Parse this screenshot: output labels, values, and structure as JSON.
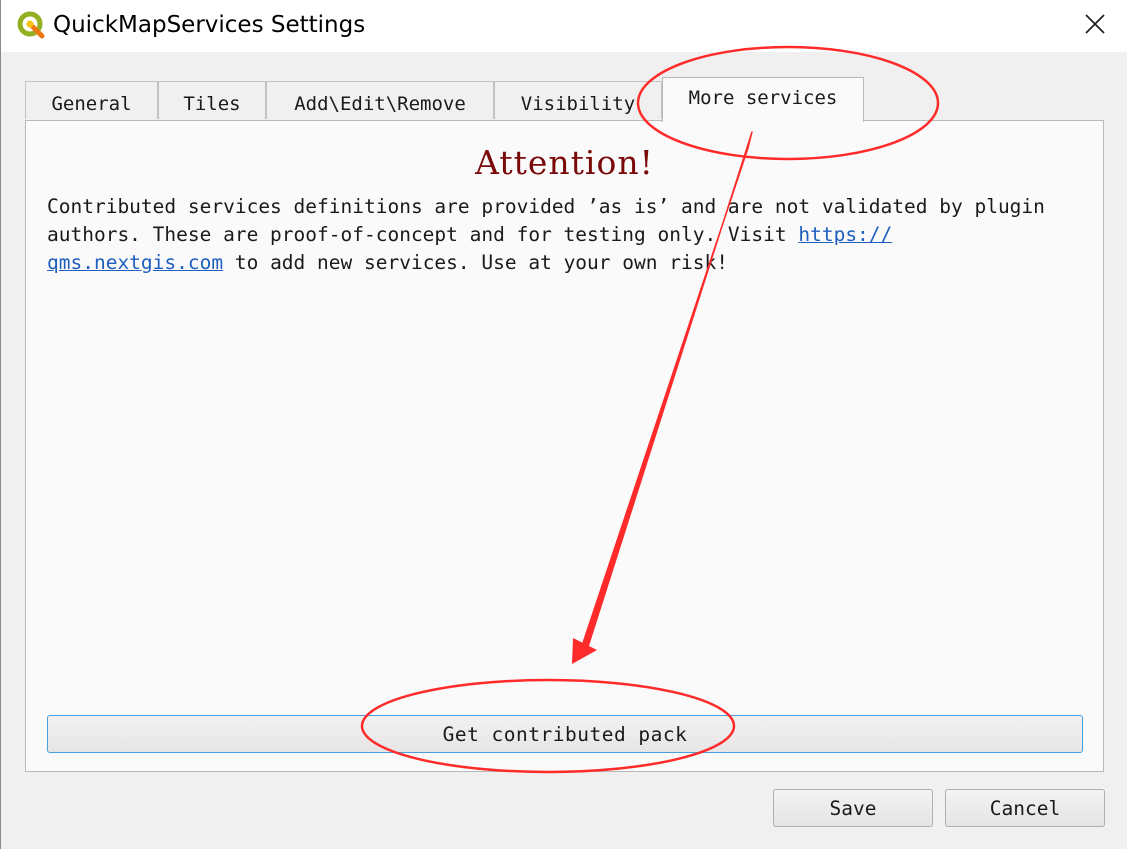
{
  "window": {
    "title": "QuickMapServices Settings",
    "app_icon": "qgis-logo-icon",
    "close_icon": "close-icon"
  },
  "tabs": [
    {
      "label": "General",
      "active": false
    },
    {
      "label": "Tiles",
      "active": false
    },
    {
      "label": "Add\\Edit\\Remove",
      "active": false
    },
    {
      "label": "Visibility",
      "active": false
    },
    {
      "label": "More services",
      "active": true
    }
  ],
  "more_services": {
    "heading": "Attention!",
    "text_before_link": "Contributed services definitions are provided ’as is’ and are not validated by plugin authors. These are proof-of-concept and for testing only. Visit ",
    "link_part1": "https://",
    "link_part2": "qms.nextgis.com",
    "text_after_link": " to add new services. Use at your own risk!",
    "get_pack_button": "Get contributed pack"
  },
  "footer": {
    "save_label": "Save",
    "cancel_label": "Cancel"
  },
  "colors": {
    "heading": "#7a0a0a",
    "link": "#1f5fbf",
    "annotation": "#ff2a2a",
    "button_focus_border": "#4a9fe0"
  },
  "annotations": {
    "type": "red-circles-and-arrow",
    "circled": [
      "tab-more-services",
      "get-contributed-pack-button"
    ]
  }
}
